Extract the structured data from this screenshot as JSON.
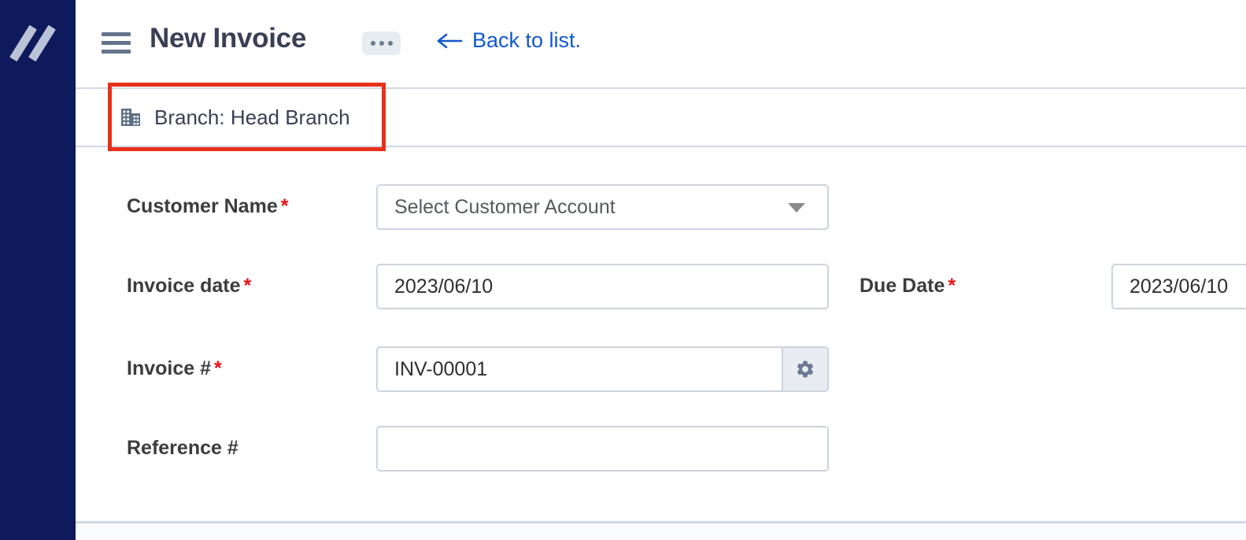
{
  "app": {
    "logo_icon": "double-slash-logo",
    "sidebar_color": "#0e1a5c"
  },
  "header": {
    "menu_icon": "hamburger-menu-icon",
    "title": "New Invoice",
    "more_icon": "ellipsis-icon",
    "back_link": "Back to list.",
    "back_icon": "arrow-left-icon",
    "link_color": "#1159cc"
  },
  "branch": {
    "icon": "building-icon",
    "label": "Branch: Head Branch",
    "highlight_color": "#e8301a"
  },
  "form": {
    "required_marker": "*",
    "fields": [
      {
        "label": "Customer Name",
        "required": true,
        "type": "select",
        "placeholder": "Select Customer Account",
        "value": "",
        "caret_icon": "chevron-down-icon"
      },
      {
        "label": "Invoice date",
        "required": true,
        "type": "date",
        "value": "2023/06/10"
      },
      {
        "label": "Due Date",
        "required": true,
        "type": "date",
        "value": "2023/06/10"
      },
      {
        "label": "Invoice #",
        "required": true,
        "type": "text",
        "value": "INV-00001",
        "action_icon": "gear-icon"
      },
      {
        "label": "Reference #",
        "required": false,
        "type": "text",
        "value": ""
      }
    ]
  }
}
